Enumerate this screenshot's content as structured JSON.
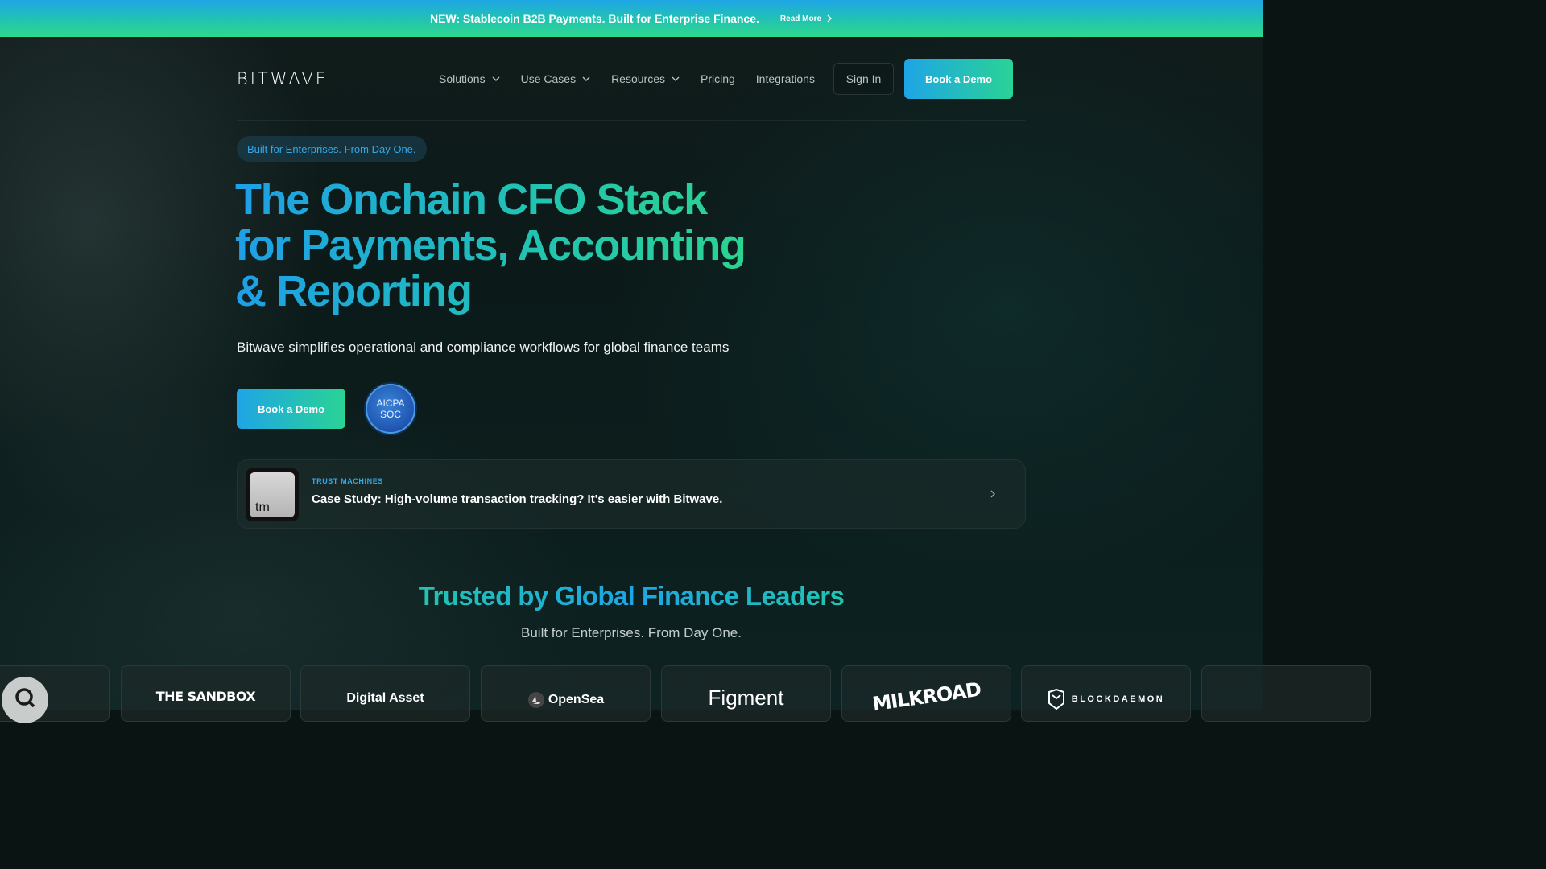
{
  "banner": {
    "text": "NEW: Stablecoin B2B Payments. Built for Enterprise Finance.",
    "link": "Read More"
  },
  "nav": {
    "logo": "BITWAVE",
    "items": [
      {
        "label": "Solutions",
        "dropdown": true
      },
      {
        "label": "Use Cases",
        "dropdown": true
      },
      {
        "label": "Resources",
        "dropdown": true
      },
      {
        "label": "Pricing",
        "dropdown": false
      },
      {
        "label": "Integrations",
        "dropdown": false
      }
    ],
    "sign_in": "Sign In",
    "cta": "Book a Demo"
  },
  "hero": {
    "pill": "Built for Enterprises. From Day One.",
    "title_lines": [
      "The Onchain CFO Stack",
      "for Payments, Accounting",
      "& Reporting"
    ],
    "subtitle": "Bitwave simplifies operational and compliance workflows for global finance teams",
    "cta": "Book a Demo",
    "badge": {
      "line1": "AICPA",
      "line2": "SOC"
    }
  },
  "case_study": {
    "tag": "TRUST MACHINES",
    "title": "Case Study: High-volume transaction tracking? It's easier with Bitwave.",
    "logo_text": "tm"
  },
  "trusted": {
    "title": "Trusted by Global Finance Leaders",
    "subtitle": "Built for Enterprises. From Day One.",
    "logos": [
      "THE SANDBOX",
      "Digital Asset",
      "OpenSea",
      "Figment",
      "MILKROAD",
      "BLOCKDAEMON"
    ]
  },
  "colors": {
    "accent_blue": "#1ea5e6",
    "accent_green": "#2ed889",
    "background": "#0a1513"
  }
}
